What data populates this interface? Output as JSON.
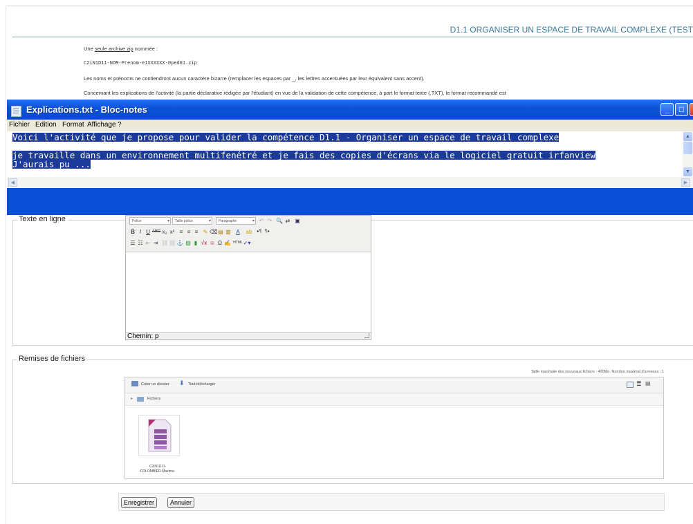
{
  "page": {
    "heading": "D1.1 ORGANISER UN ESPACE DE TRAVAIL COMPLEXE (TEST",
    "para1_prefix": "Une ",
    "para1_link1": "seule archive zip",
    "para1_suffix": " nommée :",
    "filename_pattern": "C2iN1D11-NOM-Prenom-e1XXXXXX-0ped01.zip",
    "para3": "Les noms et prénoms ne contiendront aucun caractère bizarre (remplacer les espaces par _, les lettres accentuées par leur équivalent sans accent).",
    "para4": "Concernant les explications de l'activité (la partie déclarative rédigée par l'étudiant) en vue de la validation de cette compétence, à part le format texte (.TXT), le format recommandé est"
  },
  "notepad": {
    "title": "Explications.txt - Bloc-notes",
    "menu": [
      "Fichier",
      "Edition",
      "Format",
      "Affichage",
      "?"
    ],
    "lines": [
      "Voici l'activité que je propose pour valider la compétence D1.1 - Organiser un espace de travail complexe",
      "je travaille dans un environnement multifenétré et je fais des copies d'écrans via le logiciel gratuit irfanview",
      "J'aurais pu ..."
    ],
    "selection_color": "#1c3a9a",
    "title_color": "#0b52d8"
  },
  "texte_en_ligne": {
    "legend": "Texte en ligne",
    "font_dropdown": "Police",
    "size_dropdown": "Taille police",
    "format_dropdown": "Paragraphe",
    "status": "Chemin: p"
  },
  "remises": {
    "legend": "Remises de fichiers",
    "max_info": "Taille maximale des nouveaux fichiers : 400Mo. Nombre maximal d'annexes : 1",
    "create_folder": "Créer un dossier",
    "download_all": "Tout télécharger",
    "path_root": "Fichiers",
    "file_name_line1": "C2iN1D11-",
    "file_name_line2": "COLOMBIER-Maxime-"
  },
  "buttons": {
    "save": "Enregistrer",
    "cancel": "Annuler"
  }
}
